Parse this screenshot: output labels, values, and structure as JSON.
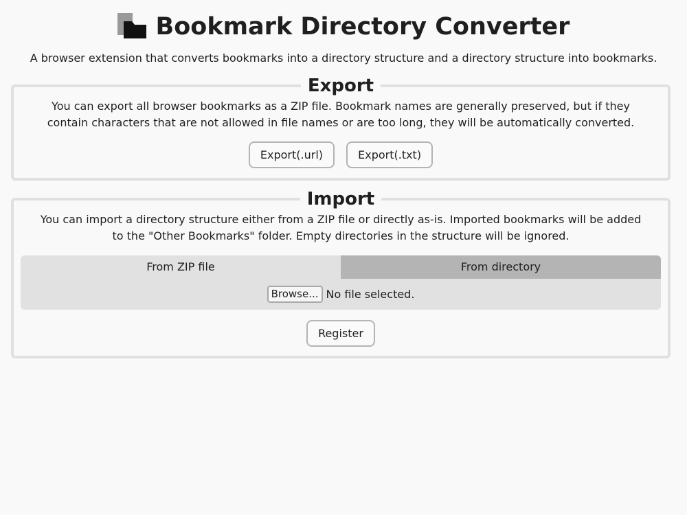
{
  "header": {
    "title": "Bookmark Directory Converter",
    "subtitle": "A browser extension that converts bookmarks into a directory structure and a directory structure into bookmarks.",
    "logo_icon": "bookmark-folder-icon"
  },
  "export": {
    "legend": "Export",
    "description": "You can export all browser bookmarks as a ZIP file. Bookmark names are generally preserved, but if they contain characters that are not allowed in file names or are too long, they will be automatically converted.",
    "buttons": {
      "export_url": "Export(.url)",
      "export_txt": "Export(.txt)"
    }
  },
  "import": {
    "legend": "Import",
    "description": "You can import a directory structure either from a ZIP file or directly as-is. Imported bookmarks will be added to the \"Other Bookmarks\" folder. Empty directories in the structure will be ignored.",
    "tabs": [
      {
        "label": "From ZIP file",
        "active": true
      },
      {
        "label": "From directory",
        "active": false
      }
    ],
    "file_input": {
      "button_label": "Browse...",
      "status": "No file selected."
    },
    "register_label": "Register"
  },
  "colors": {
    "background": "#f9f9f9",
    "border": "#e0e0e0",
    "tab_active": "#e1e1e1",
    "tab_inactive": "#b4b4b4",
    "text": "#1f1f1f"
  }
}
